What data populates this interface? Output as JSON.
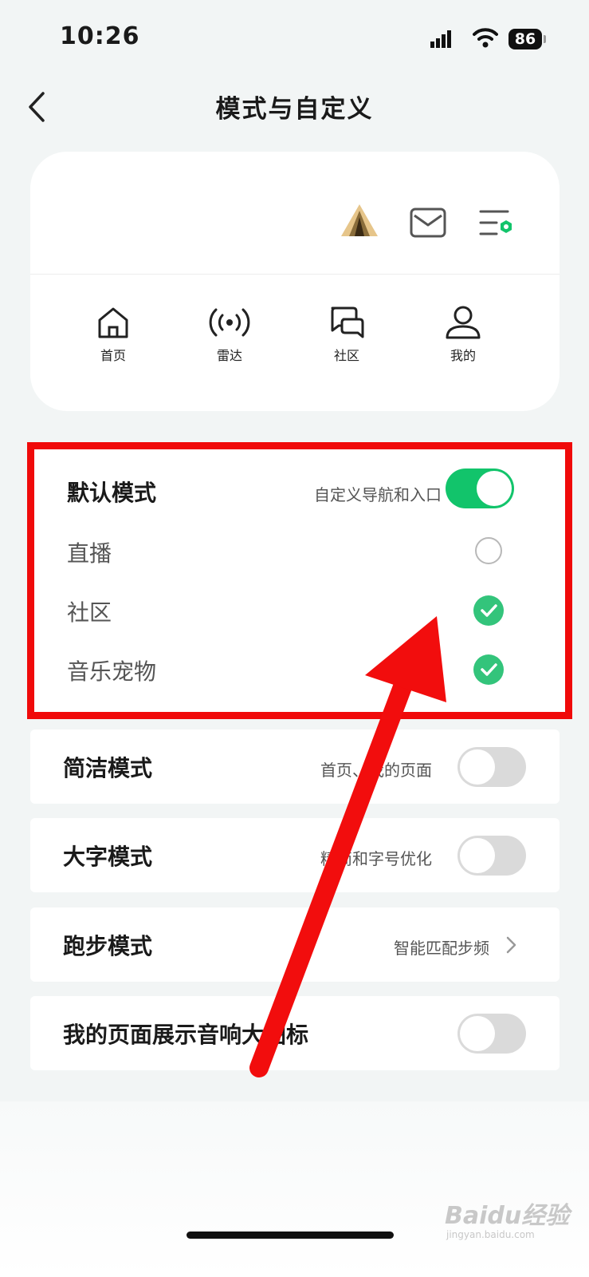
{
  "status_bar": {
    "time": "10:26",
    "battery": "86"
  },
  "nav": {
    "title": "模式与自定义"
  },
  "preview": {
    "tabs": [
      {
        "label": "首页",
        "icon": "home-icon"
      },
      {
        "label": "雷达",
        "icon": "radar-icon"
      },
      {
        "label": "社区",
        "icon": "community-icon"
      },
      {
        "label": "我的",
        "icon": "profile-icon"
      }
    ]
  },
  "default_mode": {
    "title": "默认模式",
    "desc": "自定义导航和入口",
    "enabled": true,
    "options": [
      {
        "label": "直播",
        "checked": false
      },
      {
        "label": "社区",
        "checked": true
      },
      {
        "label": "音乐宠物",
        "checked": true
      }
    ]
  },
  "simple_mode": {
    "title": "简洁模式",
    "desc": "首页、我的页面",
    "enabled": false
  },
  "large_font_mode": {
    "title": "大字模式",
    "desc": "精简和字号优化",
    "enabled": false
  },
  "running_mode": {
    "title": "跑步模式",
    "desc": "智能匹配步频"
  },
  "speaker_icon": {
    "title": "我的页面展示音响大图标",
    "enabled": false
  },
  "watermark": {
    "brand": "Baidu经验",
    "url": "jingyan.baidu.com"
  },
  "colors": {
    "accent": "#12c46b",
    "highlight": "#f00a0a",
    "check": "#33c47b"
  }
}
